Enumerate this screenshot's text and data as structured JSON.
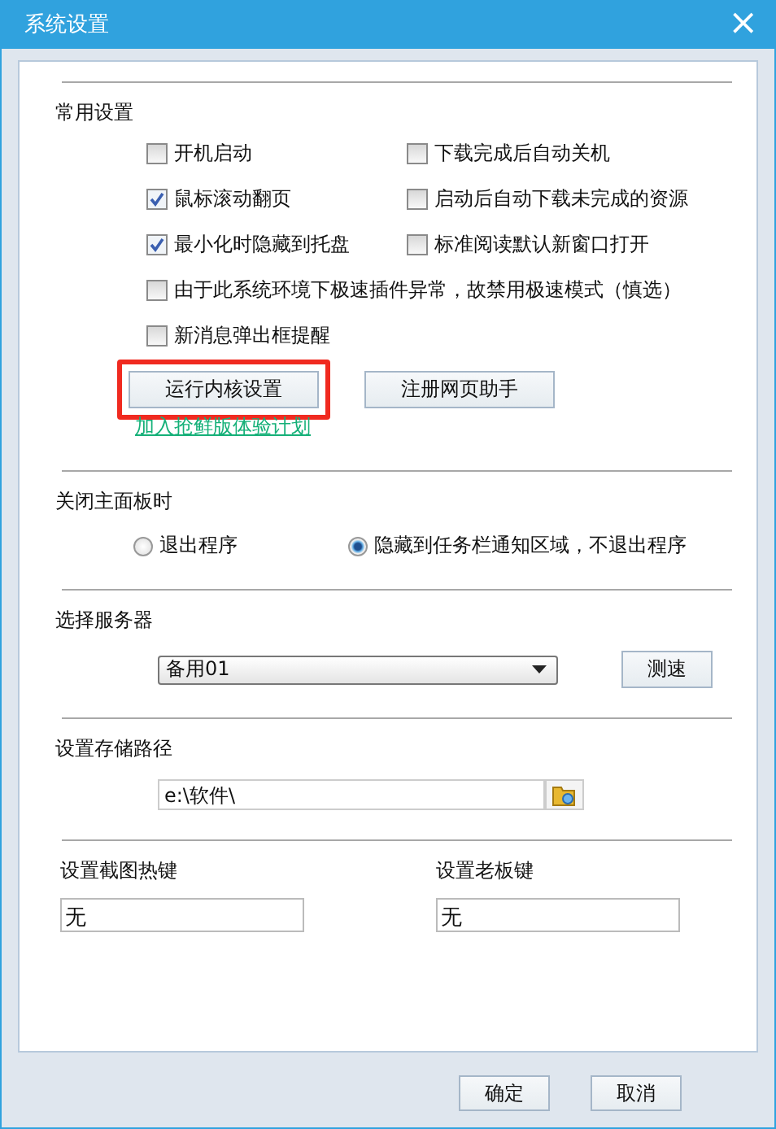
{
  "window": {
    "title": "系统设置",
    "close": "×"
  },
  "general": {
    "heading": "常用设置",
    "options": [
      {
        "label": "开机启动",
        "checked": false,
        "kind": "half"
      },
      {
        "label": "下载完成后自动关机",
        "checked": false,
        "kind": "half"
      },
      {
        "label": "鼠标滚动翻页",
        "checked": true,
        "kind": "half"
      },
      {
        "label": "启动后自动下载未完成的资源",
        "checked": false,
        "kind": "half"
      },
      {
        "label": "最小化时隐藏到托盘",
        "checked": true,
        "kind": "half"
      },
      {
        "label": "标准阅读默认新窗口打开",
        "checked": false,
        "kind": "half"
      },
      {
        "label": "由于此系统环境下极速插件异常，故禁用极速模式（慎选）",
        "checked": false,
        "kind": "full"
      },
      {
        "label": "新消息弹出框提醒",
        "checked": false,
        "kind": "full"
      }
    ],
    "buttons": [
      {
        "label": "运行内核设置",
        "highlighted": true
      },
      {
        "label": "注册网页助手",
        "highlighted": false
      }
    ],
    "link": "加入抢鲜版体验计划"
  },
  "on_close": {
    "heading": "关闭主面板时",
    "options": [
      {
        "label": "退出程序",
        "selected": false
      },
      {
        "label": "隐藏到任务栏通知区域，不退出程序",
        "selected": true
      }
    ]
  },
  "server": {
    "heading": "选择服务器",
    "value": "备用01",
    "button": "测速"
  },
  "storage": {
    "heading": "设置存储路径",
    "value": "e:\\软件\\"
  },
  "hotkeys": [
    {
      "label": "设置截图热键",
      "value": "无"
    },
    {
      "label": "设置老板键",
      "value": "无"
    }
  ],
  "footer": [
    "确定",
    "取消"
  ]
}
